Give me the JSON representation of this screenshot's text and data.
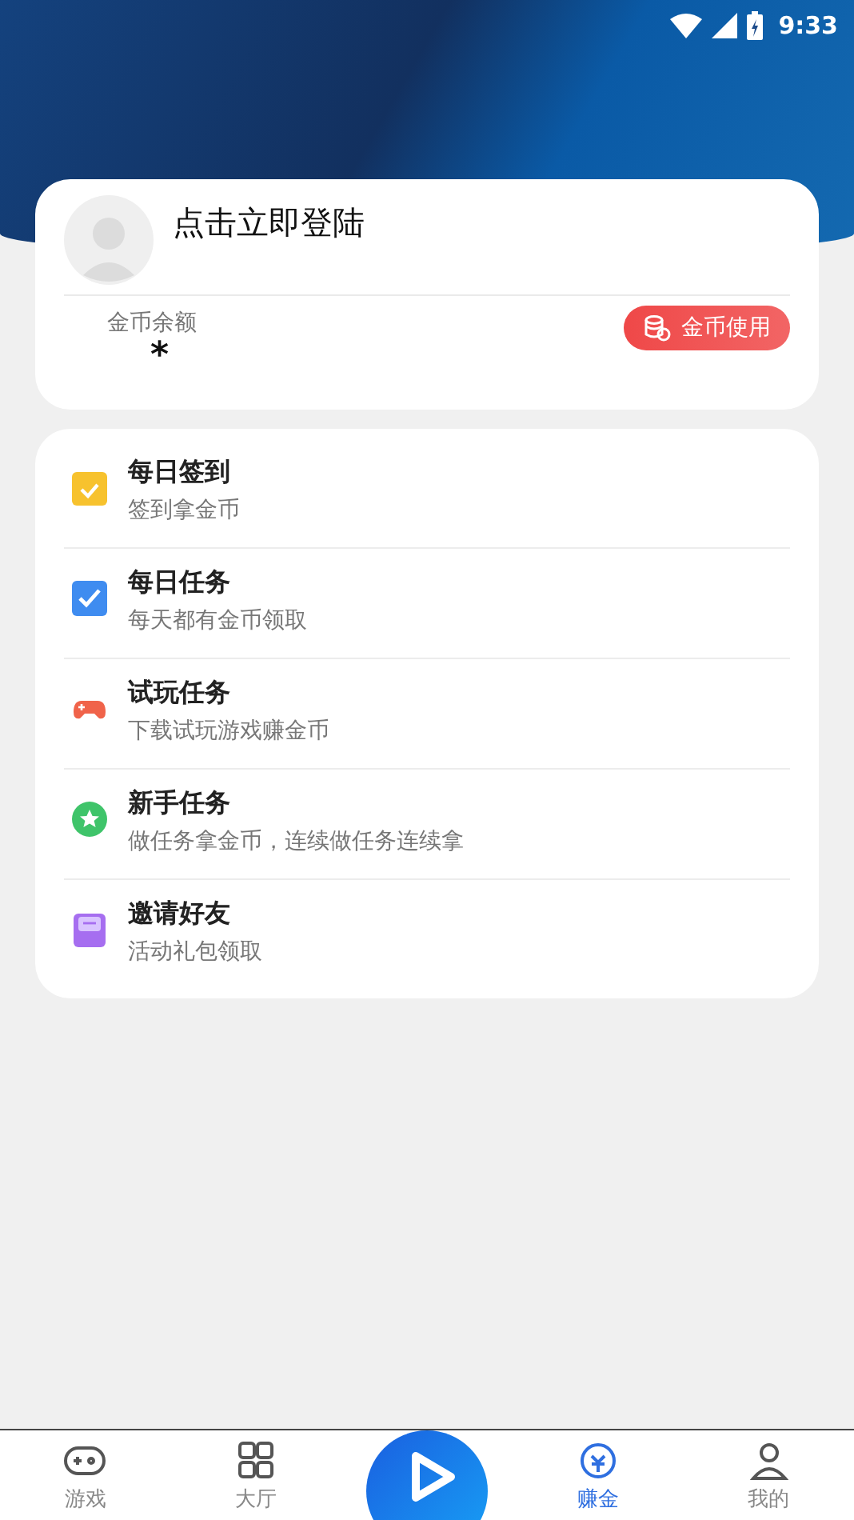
{
  "status_bar": {
    "time": "9:33"
  },
  "profile": {
    "login_text": "点击立即登陆",
    "balance_label": "金币余额",
    "balance_value": "*",
    "coin_button": "金币使用"
  },
  "tasks": [
    {
      "kind": "calendar",
      "color": "#f7c22e",
      "title": "每日签到",
      "subtitle": "签到拿金币"
    },
    {
      "kind": "check",
      "color": "#3f8cf0",
      "title": "每日任务",
      "subtitle": "每天都有金币领取"
    },
    {
      "kind": "gamepad",
      "color": "#f0634a",
      "title": "试玩任务",
      "subtitle": "下载试玩游戏赚金币"
    },
    {
      "kind": "star",
      "color": "#3fc46a",
      "title": "新手任务",
      "subtitle": "做任务拿金币，连续做任务连续拿"
    },
    {
      "kind": "mail",
      "color": "#a66ef0",
      "title": "邀请好友",
      "subtitle": "活动礼包领取"
    }
  ],
  "nav": [
    {
      "kind": "gamepad",
      "label": "游戏",
      "selected": false
    },
    {
      "kind": "grid",
      "label": "大厅",
      "selected": false
    },
    {
      "kind": "play"
    },
    {
      "kind": "coin",
      "label": "赚金",
      "selected": true
    },
    {
      "kind": "person",
      "label": "我的",
      "selected": false
    }
  ]
}
